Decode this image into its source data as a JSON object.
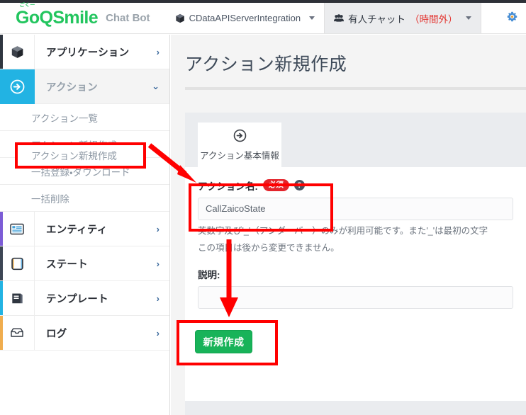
{
  "header": {
    "brand_furigana": "ごくー",
    "brand_name": "GoQSmile",
    "brand_sub": "Chat Bot",
    "app_selector": "CDataAPIServerIntegration",
    "chat_status_main": "有人チャット",
    "chat_status_note": "（時間外）",
    "gear_icon": "gear-icon",
    "cube_icon": "cube-icon",
    "people_icon": "people-icon"
  },
  "sidebar": {
    "items": [
      {
        "label": "アプリケーション",
        "icon": "cube-icon",
        "chevron": "›",
        "accent": "#2f3640",
        "active": false
      },
      {
        "label": "アクション",
        "icon": "arrow-circle-icon",
        "chevron": "⌄",
        "accent": "#22b3e3",
        "active": true
      },
      {
        "label": "エンティティ",
        "icon": "list-icon",
        "chevron": "›",
        "accent": "#7c5cd6",
        "active": false
      },
      {
        "label": "ステート",
        "icon": "square-icon",
        "chevron": "›",
        "accent": "#3d4654",
        "active": false
      },
      {
        "label": "テンプレート",
        "icon": "book-icon",
        "chevron": "›",
        "accent": "#22b3e3",
        "active": false
      },
      {
        "label": "ログ",
        "icon": "tray-icon",
        "chevron": "›",
        "accent": "#f0ad4e",
        "active": false
      }
    ],
    "sub_items": [
      {
        "label": "アクション一覧"
      },
      {
        "label": "アクション新規作成"
      },
      {
        "label": "一括登録・ダウンロード"
      },
      {
        "label": "一括削除"
      }
    ]
  },
  "main": {
    "page_title": "アクション新規作成",
    "tab": {
      "icon": "arrow-circle-icon",
      "label": "アクション基本情報"
    },
    "form": {
      "name_label": "アクション名:",
      "required_badge": "必須",
      "help_icon": "question-mark-icon",
      "name_value": "CallZaicoState",
      "name_placeholder": "",
      "hint_line1": "英数字及び'_'（アンダーバー）のみが利用可能です。また'_'は最初の文字",
      "hint_line2": "この項目は後から変更できません。",
      "desc_label": "説明:",
      "desc_value": "",
      "desc_placeholder": "",
      "submit_label": "新規作成"
    }
  },
  "annotations": {
    "color": "#ff0000",
    "boxes": [
      {
        "name": "highlight-sidebar-new-action"
      },
      {
        "name": "highlight-action-name-field"
      },
      {
        "name": "highlight-create-button"
      }
    ],
    "arrows": [
      {
        "name": "arrow-to-action-name-field"
      },
      {
        "name": "arrow-to-create-button"
      }
    ]
  }
}
